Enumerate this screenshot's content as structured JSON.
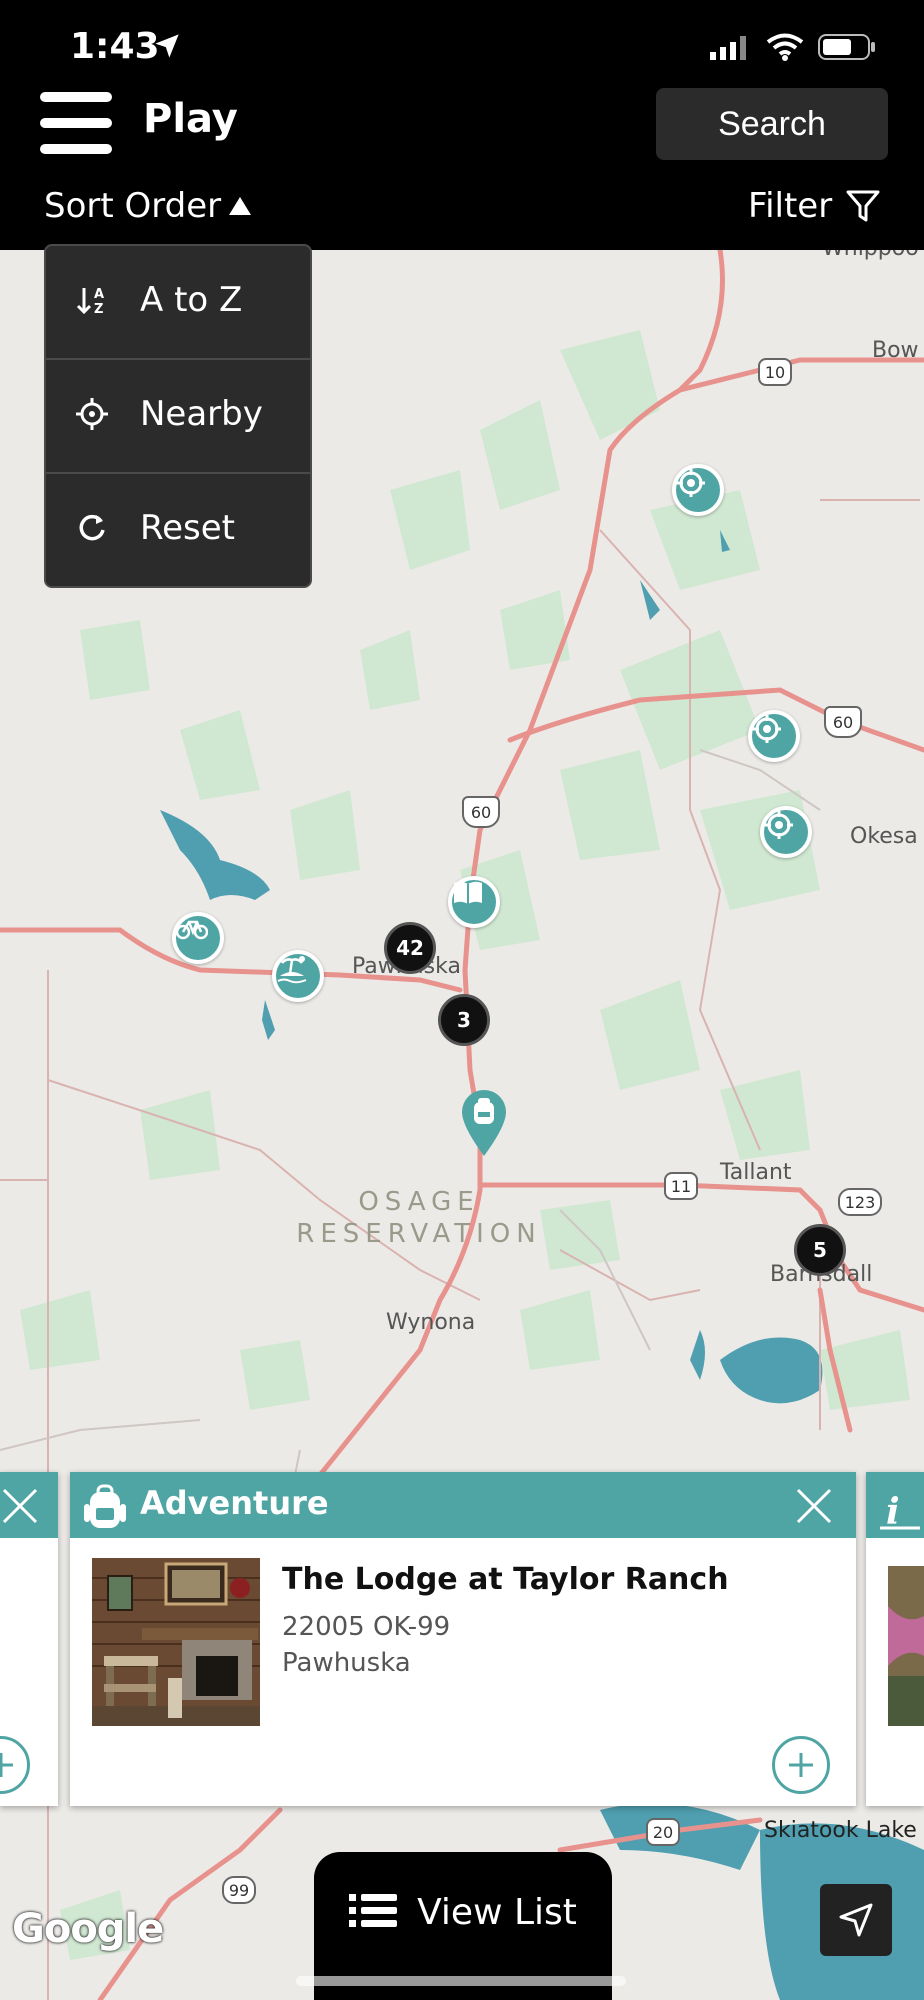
{
  "status": {
    "time": "1:43"
  },
  "header": {
    "title": "Play",
    "search_label": "Search",
    "sort_label": "Sort Order",
    "filter_label": "Filter"
  },
  "sort_menu": {
    "items": [
      {
        "label": "A to Z"
      },
      {
        "label": "Nearby"
      },
      {
        "label": "Reset"
      }
    ]
  },
  "map": {
    "labels": {
      "pawhuska": "Pawhuska",
      "wynona": "Wynona",
      "tallant": "Tallant",
      "barnsdall": "Barnsdall",
      "okesa": "Okesa",
      "whippoo": "Whippoo",
      "bow": "Bow",
      "skiatook": "Skiatook Lake"
    },
    "reservation": [
      "OSAGE",
      "RESERVATION"
    ],
    "route_shields": [
      "10",
      "60",
      "60",
      "11",
      "123",
      "20",
      "99"
    ],
    "clusters": [
      "42",
      "3",
      "5"
    ]
  },
  "card": {
    "category": "Adventure",
    "name": "The Lodge at Taylor Ranch",
    "address": "22005 OK-99",
    "city": "Pawhuska"
  },
  "bottom": {
    "view_list_label": "View List",
    "google_label": "Google"
  },
  "colors": {
    "accent": "#4fa5a3",
    "header_bg": "#000000",
    "menu_bg": "#2b2b2b"
  }
}
